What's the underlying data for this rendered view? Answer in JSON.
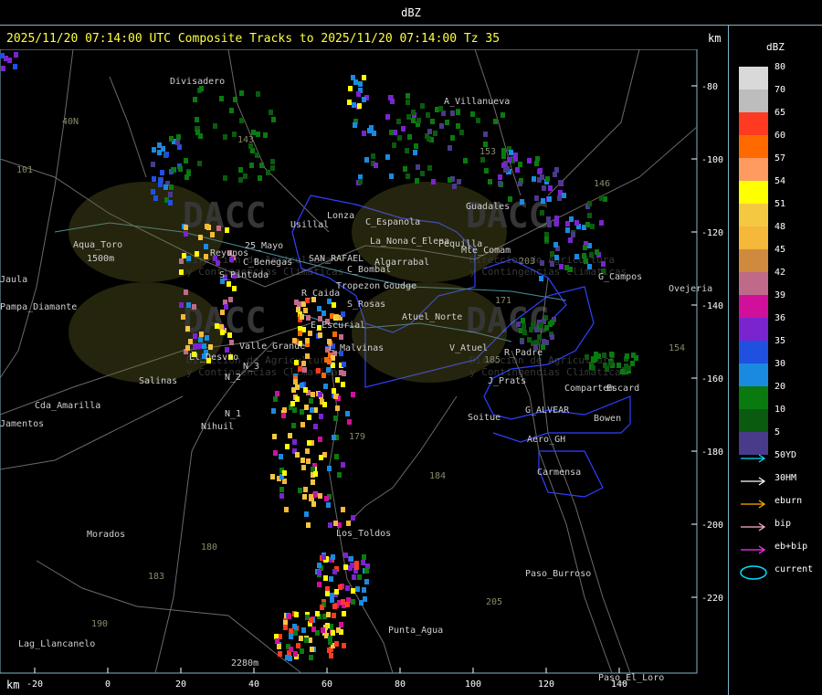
{
  "window_title": "dBZ",
  "headline": "2025/11/20 07:14:00 UTC Composite Tracks to 2025/11/20 07:14:00 Tz 35",
  "axis_unit": "km",
  "y_ticks": [
    "-80",
    "-100",
    "-120",
    "-140",
    "-160",
    "-180",
    "-200",
    "-220"
  ],
  "x_ticks": [
    "-20",
    "0",
    "20",
    "40",
    "60",
    "80",
    "100",
    "120",
    "140"
  ],
  "legend": {
    "title": "dBZ",
    "scale": [
      {
        "label": "80",
        "color": "#d9d9d9"
      },
      {
        "label": "70",
        "color": "#bdbdbd"
      },
      {
        "label": "65",
        "color": "#ff3a22"
      },
      {
        "label": "60",
        "color": "#ff6a00"
      },
      {
        "label": "57",
        "color": "#ff9a60"
      },
      {
        "label": "54",
        "color": "#ffff00"
      },
      {
        "label": "51",
        "color": "#f5c842"
      },
      {
        "label": "48",
        "color": "#f5b83a"
      },
      {
        "label": "45",
        "color": "#d08a3e"
      },
      {
        "label": "42",
        "color": "#c06a8a"
      },
      {
        "label": "39",
        "color": "#d0109a"
      },
      {
        "label": "36",
        "color": "#7a24d0"
      },
      {
        "label": "35",
        "color": "#2050e0"
      },
      {
        "label": "30",
        "color": "#1a8ae0"
      },
      {
        "label": "20",
        "color": "#0a7a10"
      },
      {
        "label": "10",
        "color": "#0a5a10"
      },
      {
        "label": "5",
        "color": "#4a3a8a"
      }
    ],
    "tracks": [
      {
        "label": "50YD",
        "color": "#00e0ff"
      },
      {
        "label": "30HM",
        "color": "#ffffff"
      },
      {
        "label": "eburn",
        "color": "#ffb000"
      },
      {
        "label": "bip",
        "color": "#ffb0d0"
      },
      {
        "label": "eb+bip",
        "color": "#ff30ff"
      },
      {
        "label": "current",
        "color": "#00e0ff"
      }
    ]
  },
  "watermarks": [
    {
      "logo": "DACC",
      "line1": "Direccion de Agricultura",
      "line2": "y Contingencias Climaticas"
    }
  ],
  "place_labels": [
    "Divisadero",
    "A_Villanueva",
    "Guadales",
    "Aqua_Toro",
    "1500m",
    "Pampa_Diamante",
    "Jaula",
    "Lonza",
    "Usillal",
    "C_Espanola",
    "La_Nona",
    "C_Elena",
    "Pequilla",
    "Mte_Comam",
    "Reyunos",
    "25_Mayo",
    "C_Benegas",
    "SAN_RAFAEL",
    "Algarrabal",
    "S_Pintada",
    "C_Bombal",
    "Tropezon",
    "Goudge",
    "R_Caida",
    "S_Rosas",
    "Atuel_Norte",
    "E_Escurial",
    "L_Malvinas",
    "Valle_Grande",
    "V_Atuel",
    "R_Padre",
    "El_Desvio",
    "N_3",
    "N_2",
    "N_1",
    "Salinas",
    "Nihuil",
    "Cda_Amarilla",
    "Jamentos",
    "J_Prats",
    "Compartem",
    "Escard",
    "Soitue",
    "G_ALVEAR",
    "Bowen",
    "Aero_GH",
    "Carmensa",
    "Morados",
    "Los_Toldos",
    "Paso_Burroso",
    "Punta_Agua",
    "Lag_Llancanelo",
    "2280m",
    "Paso_El_Loro",
    "G_Campos",
    "Ovejeria",
    "40N",
    "143",
    "153",
    "146",
    "101",
    "203",
    "171",
    "185",
    "179",
    "184",
    "180",
    "183",
    "190",
    "205",
    "154"
  ]
}
